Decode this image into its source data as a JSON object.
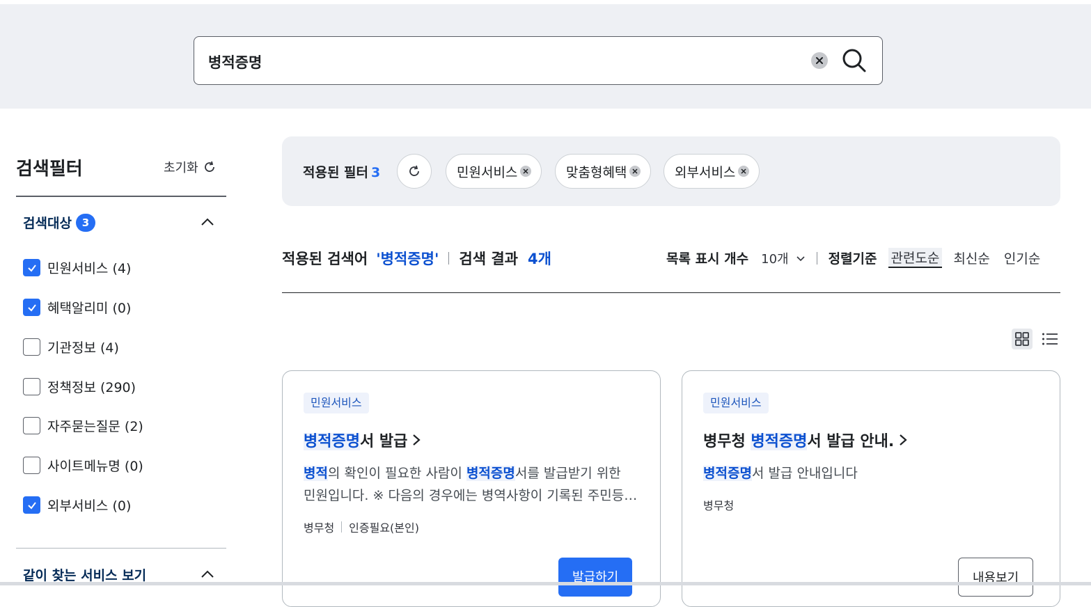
{
  "search": {
    "query": "병적증명"
  },
  "sidebar": {
    "title": "검색필터",
    "reset_label": "초기화",
    "section1": {
      "title": "검색대상",
      "count": "3"
    },
    "items": [
      {
        "label": "민원서비스 (4)",
        "checked": true
      },
      {
        "label": "혜택알리미 (0)",
        "checked": true
      },
      {
        "label": "기관정보 (4)",
        "checked": false
      },
      {
        "label": "정책정보 (290)",
        "checked": false
      },
      {
        "label": "자주묻는질문 (2)",
        "checked": false
      },
      {
        "label": "사이트메뉴명 (0)",
        "checked": false
      },
      {
        "label": "외부서비스 (0)",
        "checked": true
      }
    ],
    "section2": {
      "title": "같이 찾는 서비스 보기"
    }
  },
  "filters": {
    "label": "적용된 필터",
    "count": "3",
    "chips": [
      "민원서비스",
      "맞춤형혜택",
      "외부서비스"
    ]
  },
  "results": {
    "applied_label": "적용된 검색어",
    "keyword": "'병적증명'",
    "result_label": "검색 결과",
    "result_count": "4개",
    "list_count_label": "목록 표시 개수",
    "list_count_value": "10개",
    "sort_label": "정렬기준",
    "sort_options": [
      "관련도순",
      "최신순",
      "인기순"
    ]
  },
  "cards": [
    {
      "tag": "민원서비스",
      "title_hl": "병적증명",
      "title_rest": "서 발급",
      "desc_parts": [
        [
          "병적",
          true
        ],
        [
          "의 확인이 필요한 사람이 ",
          false
        ],
        [
          "병적증명",
          true
        ],
        [
          "서를 발급받기 위한",
          false
        ]
      ],
      "desc_line2": "민원입니다. ※ 다음의 경우에는 병역사항이 기록된 주민등록초본",
      "agency": "병무청",
      "auth": "인증필요(본인)",
      "button": "발급하기"
    },
    {
      "tag": "민원서비스",
      "title_pre": "병무청 ",
      "title_hl": "병적증명",
      "title_rest": "서 발급 안내.",
      "desc_hl": "병적증명",
      "desc_rest": "서 발급 안내입니다",
      "agency": "병무청",
      "button": "내용보기"
    }
  ]
}
